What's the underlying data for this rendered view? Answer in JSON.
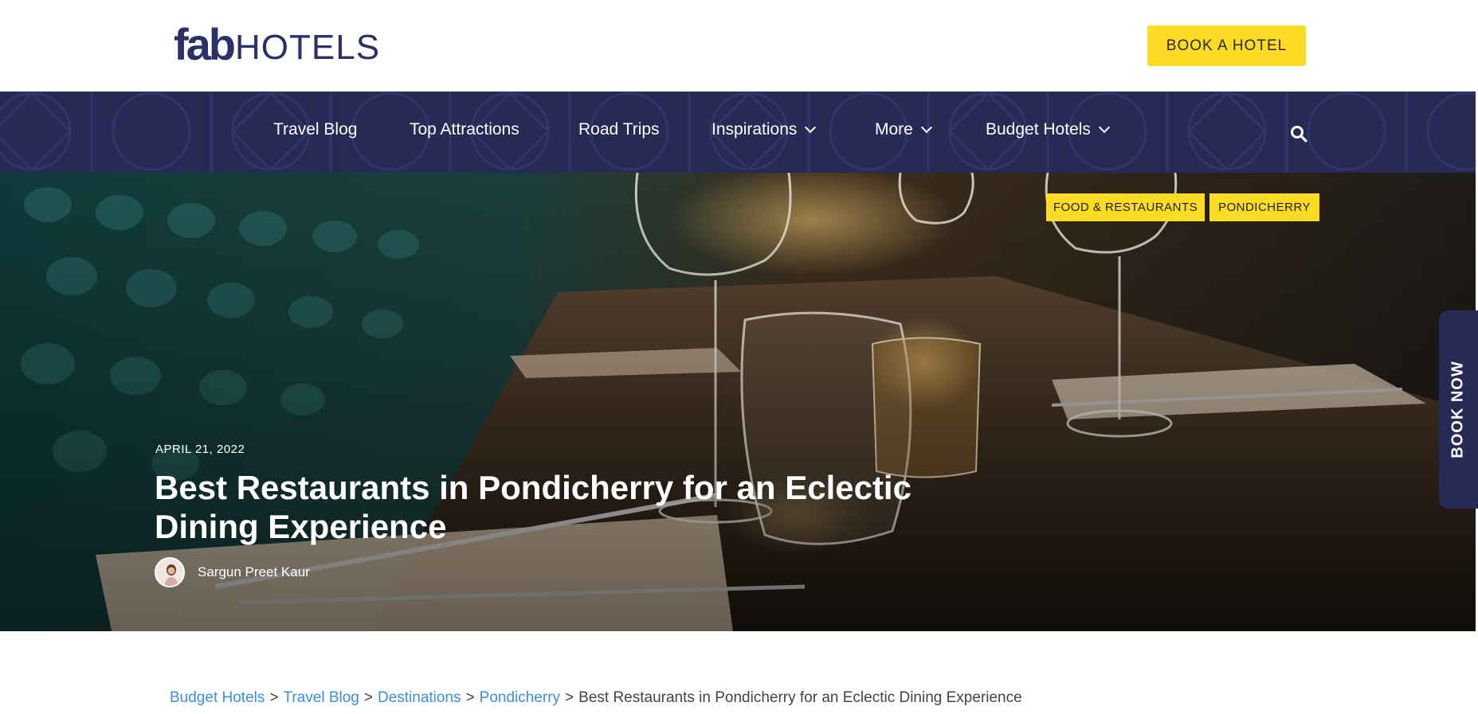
{
  "header": {
    "logo_bold": "fab",
    "logo_light": "HOTELS",
    "book_button_label": "BOOK A HOTEL"
  },
  "nav": {
    "items": [
      {
        "label": "Travel Blog",
        "has_dropdown": false
      },
      {
        "label": "Top Attractions",
        "has_dropdown": false
      },
      {
        "label": "Road Trips",
        "has_dropdown": false
      },
      {
        "label": "Inspirations",
        "has_dropdown": true
      },
      {
        "label": "More",
        "has_dropdown": true
      },
      {
        "label": "Budget Hotels",
        "has_dropdown": true
      }
    ],
    "search_icon": "search-icon",
    "background_color": "#272a55"
  },
  "hero": {
    "tags": [
      "FOOD & RESTAURANTS",
      "PONDICHERRY"
    ],
    "date": "APRIL 21, 2022",
    "title": "Best Restaurants in Pondicherry for an Eclectic Dining Experience",
    "author": "Sargun Preet Kaur"
  },
  "side_tab": {
    "label": "BOOK NOW"
  },
  "breadcrumb": {
    "links": [
      "Budget Hotels",
      "Travel Blog",
      "Destinations",
      "Pondicherry"
    ],
    "separator": ">",
    "current": "Best Restaurants in Pondicherry for an Eclectic Dining Experience"
  },
  "colors": {
    "accent_yellow": "#fcdb23",
    "navy": "#272a55",
    "link_blue": "#3b8fe0"
  }
}
